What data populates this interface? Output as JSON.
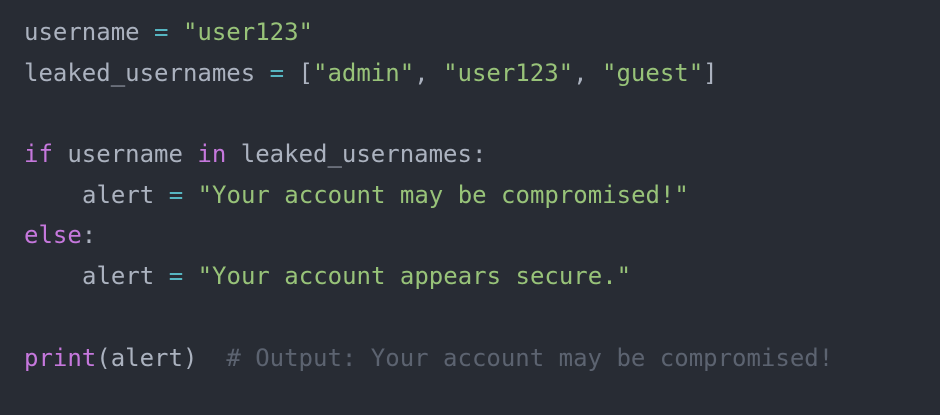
{
  "code": {
    "line1": {
      "var": "username",
      "op": "=",
      "str": "\"user123\""
    },
    "line2": {
      "var": "leaked_usernames",
      "op": "=",
      "open": "[",
      "items": [
        "\"admin\"",
        "\"user123\"",
        "\"guest\""
      ],
      "sep": ", ",
      "close": "]"
    },
    "line4": {
      "kw_if": "if",
      "var": "username",
      "kw_in": "in",
      "list": "leaked_usernames",
      "colon": ":"
    },
    "line5": {
      "var": "alert",
      "op": "=",
      "str": "\"Your account may be compromised!\""
    },
    "line6": {
      "kw_else": "else",
      "colon": ":"
    },
    "line7": {
      "var": "alert",
      "op": "=",
      "str": "\"Your account appears secure.\""
    },
    "line9": {
      "fn": "print",
      "open": "(",
      "arg": "alert",
      "close": ")",
      "comment": "# Output: Your account may be compromised!"
    }
  },
  "colors": {
    "background": "#282c34",
    "identifier": "#abb2bf",
    "operator": "#56b6c2",
    "string": "#98c379",
    "keyword": "#c678dd",
    "comment": "#5c6370"
  }
}
